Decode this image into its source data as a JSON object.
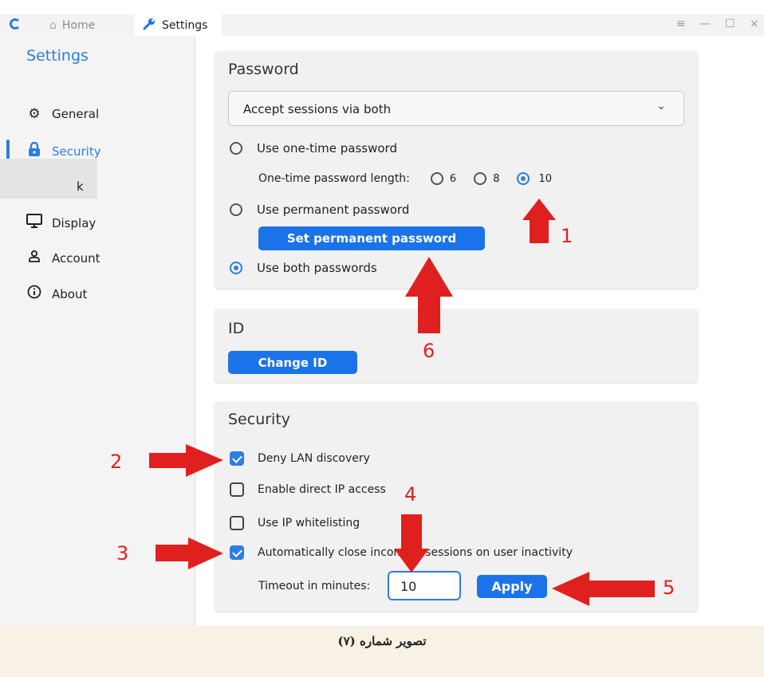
{
  "tabs": {
    "home": "Home",
    "settings": "Settings"
  },
  "window_controls": {
    "menu": "≡",
    "minimize": "—",
    "maximize": "☐",
    "close": "×"
  },
  "sidebar": {
    "title": "Settings",
    "items": [
      {
        "label": "General",
        "icon": "gear-icon"
      },
      {
        "label": "Security",
        "icon": "lock-icon"
      },
      {
        "label": "k",
        "icon": "network-icon"
      },
      {
        "label": "Display",
        "icon": "monitor-icon"
      },
      {
        "label": "Account",
        "icon": "user-icon"
      },
      {
        "label": "About",
        "icon": "info-icon"
      }
    ]
  },
  "password": {
    "title": "Password",
    "select_value": "Accept sessions via both",
    "one_time": "Use one-time password",
    "length_label": "One-time password length:",
    "length_options": [
      "6",
      "8",
      "10"
    ],
    "selected_length": "10",
    "permanent": "Use permanent password",
    "set_permanent_button": "Set permanent password",
    "both": "Use both passwords"
  },
  "id_card": {
    "title": "ID",
    "change_button": "Change ID"
  },
  "security": {
    "title": "Security",
    "deny_lan": "Deny LAN discovery",
    "direct_ip": "Enable direct IP access",
    "whitelist": "Use IP whitelisting",
    "auto_close": "Automatically close incoming sessions on user inactivity",
    "timeout_label": "Timeout in minutes:",
    "timeout_value": "10",
    "apply_button": "Apply"
  },
  "annotations": [
    "1",
    "2",
    "3",
    "4",
    "5",
    "6"
  ],
  "caption": "تصویر شماره (۷)",
  "colors": {
    "accent": "#2e7de0",
    "button": "#1a73e8",
    "arrow": "#e0201e"
  }
}
